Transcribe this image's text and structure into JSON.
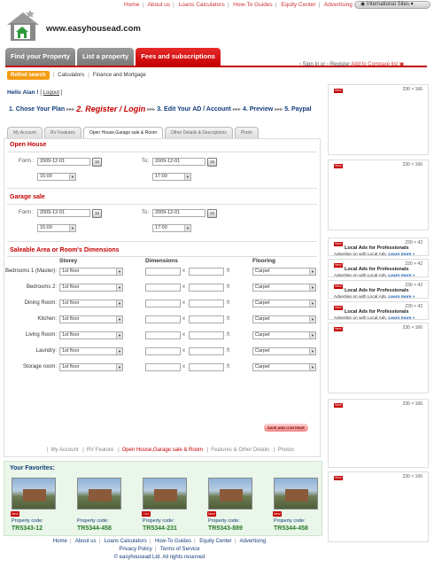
{
  "top_links": [
    "Home",
    "About us",
    "Loans Calculators",
    "How-To Guides",
    "Equity Center",
    "Advertising"
  ],
  "intl_sites": "International Sites",
  "brand": "www.easyhousead.com",
  "main_tabs": [
    "Find your Property",
    "List a property",
    "Fees and subscriptions"
  ],
  "signin": {
    "sign_in": "Sign In",
    "or": "or",
    "register": "Register",
    "compare": "Add to Compare list"
  },
  "subnav": {
    "refind": "Refind search",
    "calculators": "Calculators",
    "finance": "Finance and Mortgage"
  },
  "hello": {
    "text": "Hello Alan !",
    "logout": "Logout"
  },
  "steps": [
    "1. Chose Your Plan",
    "2. Register / Login",
    "3. Edit Your AD / Account",
    "4. Preview",
    "5. Paypal"
  ],
  "form_tabs": [
    "My Account",
    "RV Features",
    "Open House,Garage sale & Room",
    "Other Details & Descriptions",
    "Photo"
  ],
  "open_house": {
    "title": "Open House",
    "from_label": "Form :",
    "to_label": "To:",
    "from_date": "2009-12-01",
    "to_date": "2009-12-01",
    "from_time": "15:00",
    "to_time": "17:00"
  },
  "garage_sale": {
    "title": "Garage sale",
    "from_label": "Form :",
    "to_label": "To:",
    "from_date": "2009-12-01",
    "to_date": "2009-12-01",
    "from_time": "15:00",
    "to_time": "17:00"
  },
  "rooms": {
    "title": "Saleable Area or Room's Dimensions",
    "headers": {
      "storey": "Storey",
      "dimensions": "Dimensions",
      "flooring": "Flooring"
    },
    "unit": "ft",
    "times": "x",
    "rows": [
      {
        "label": "Bedrooms 1 (Master):",
        "storey": "1st floor",
        "flooring": "Carpet"
      },
      {
        "label": "Bedrooms 2:",
        "storey": "1st floor",
        "flooring": "Carpet"
      },
      {
        "label": "Dining Room:",
        "storey": "1st floor",
        "flooring": "Carpet"
      },
      {
        "label": "Kitchen:",
        "storey": "1st floor",
        "flooring": "Carpet"
      },
      {
        "label": "Living Room:",
        "storey": "1st floor",
        "flooring": "Carpet"
      },
      {
        "label": "Laundry:",
        "storey": "1st floor",
        "flooring": "Carpet"
      },
      {
        "label": "Storage room:",
        "storey": "1st floor",
        "flooring": "Carpet"
      }
    ]
  },
  "save_button": "SAVE AND CONTINUE",
  "bottom_tabs": [
    "My Account",
    "RV Feature",
    "Open House,Garage sale & Room",
    "Features & Other Details",
    "Photos"
  ],
  "favorites": {
    "title": "Your Favorites:",
    "label": "Property code:",
    "items": [
      {
        "code": "TR5343-12",
        "badge": "New!"
      },
      {
        "code": "TR5344-458",
        "badge": ""
      },
      {
        "code": "TR5344-231",
        "badge": "Hot"
      },
      {
        "code": "TR5343-889",
        "badge": "New!"
      },
      {
        "code": "TR5344-458",
        "badge": "New!"
      }
    ]
  },
  "footer": {
    "links": [
      "Home",
      "About us",
      "Loans Calculators",
      "How-To Guides",
      "Equity Center",
      "Advertising"
    ],
    "links2": [
      "Privacy Policy",
      "Terms of Service"
    ],
    "copyright": "© easyhousead Ltd. All rights reserved"
  },
  "ads": {
    "size_big": "230 × 166",
    "size_small": "230 × 42",
    "new_badge": "New!",
    "small_title": "Local Ads for Professionals",
    "small_sub": "Advertise on      with Local Ads.",
    "learn_more": "Learn more »"
  },
  "colors": {
    "brand_red": "#c40000",
    "nav_gray": "#888888",
    "link_blue": "#123c7a",
    "accent_orange": "#f39c12"
  }
}
